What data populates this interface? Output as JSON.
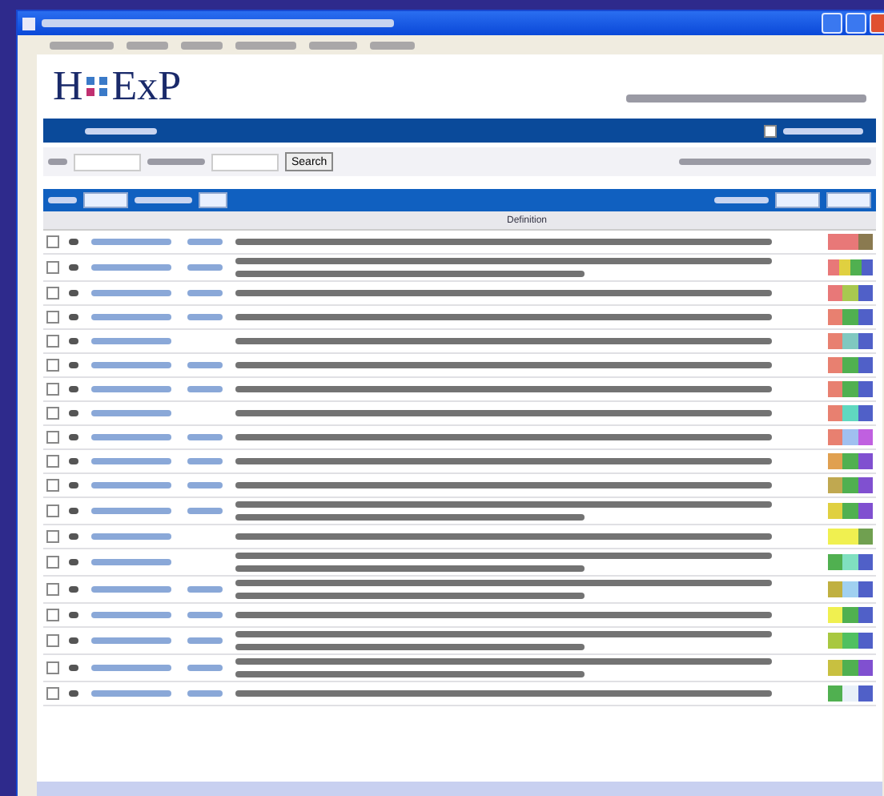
{
  "logo": {
    "left": "H",
    "right": "ExP"
  },
  "nav": {
    "checked": false
  },
  "search": {
    "button": "Search"
  },
  "table": {
    "header": "Definition",
    "rows": [
      {
        "checked": false,
        "kind": "single",
        "ref_link": true,
        "segments": [
          {
            "color": "#e87878"
          },
          {
            "color": "#e87878"
          },
          {
            "color": "#8a7a50"
          }
        ]
      },
      {
        "checked": false,
        "kind": "double",
        "ref_link": true,
        "segments": [
          {
            "color": "#e87878"
          },
          {
            "color": "#e0d040"
          },
          {
            "color": "#50b050"
          },
          {
            "color": "#5060c8"
          }
        ]
      },
      {
        "checked": false,
        "kind": "single",
        "ref_link": true,
        "segments": [
          {
            "color": "#e87878"
          },
          {
            "color": "#a8c850"
          },
          {
            "color": "#5060c8"
          }
        ]
      },
      {
        "checked": false,
        "kind": "single",
        "ref_link": true,
        "segments": [
          {
            "color": "#e88070"
          },
          {
            "color": "#50b050"
          },
          {
            "color": "#5060c8"
          }
        ]
      },
      {
        "checked": false,
        "kind": "single",
        "ref_link": false,
        "segments": [
          {
            "color": "#e88070"
          },
          {
            "color": "#80c8c0"
          },
          {
            "color": "#5060c8"
          }
        ]
      },
      {
        "checked": false,
        "kind": "single",
        "ref_link": true,
        "segments": [
          {
            "color": "#e88070"
          },
          {
            "color": "#50b050"
          },
          {
            "color": "#5060c8"
          }
        ]
      },
      {
        "checked": false,
        "kind": "single",
        "ref_link": true,
        "segments": [
          {
            "color": "#e88070"
          },
          {
            "color": "#50b050"
          },
          {
            "color": "#5060c8"
          }
        ]
      },
      {
        "checked": false,
        "kind": "single",
        "ref_link": false,
        "segments": [
          {
            "color": "#e88070"
          },
          {
            "color": "#60d8c0"
          },
          {
            "color": "#5060c8"
          }
        ]
      },
      {
        "checked": false,
        "kind": "single",
        "ref_link": true,
        "segments": [
          {
            "color": "#e88070"
          },
          {
            "color": "#a0c0f0"
          },
          {
            "color": "#c060e0"
          }
        ]
      },
      {
        "checked": false,
        "kind": "single",
        "ref_link": true,
        "segments": [
          {
            "color": "#e0a050"
          },
          {
            "color": "#50b050"
          },
          {
            "color": "#8050d0"
          }
        ]
      },
      {
        "checked": false,
        "kind": "single",
        "ref_link": true,
        "segments": [
          {
            "color": "#c0a850"
          },
          {
            "color": "#50b050"
          },
          {
            "color": "#8050d0"
          }
        ]
      },
      {
        "checked": false,
        "kind": "double",
        "ref_link": true,
        "segments": [
          {
            "color": "#e0d040"
          },
          {
            "color": "#50b050"
          },
          {
            "color": "#8050d0"
          }
        ]
      },
      {
        "checked": false,
        "kind": "single",
        "ref_link": false,
        "segments": [
          {
            "color": "#f0f050"
          },
          {
            "color": "#f0f050"
          },
          {
            "color": "#70a050"
          }
        ]
      },
      {
        "checked": false,
        "kind": "double",
        "ref_link": false,
        "segments": [
          {
            "color": "#50b050"
          },
          {
            "color": "#80e0c0"
          },
          {
            "color": "#5060c8"
          }
        ]
      },
      {
        "checked": false,
        "kind": "double",
        "ref_link": true,
        "segments": [
          {
            "color": "#c0b040"
          },
          {
            "color": "#a0d0f0"
          },
          {
            "color": "#5060c8"
          }
        ]
      },
      {
        "checked": false,
        "kind": "single",
        "ref_link": true,
        "segments": [
          {
            "color": "#f0f050"
          },
          {
            "color": "#50b050"
          },
          {
            "color": "#5060c8"
          }
        ]
      },
      {
        "checked": false,
        "kind": "double",
        "ref_link": true,
        "segments": [
          {
            "color": "#a8c840"
          },
          {
            "color": "#50c060"
          },
          {
            "color": "#5060c8"
          }
        ]
      },
      {
        "checked": false,
        "kind": "double",
        "ref_link": true,
        "segments": [
          {
            "color": "#c8c040"
          },
          {
            "color": "#50b050"
          },
          {
            "color": "#8050d0"
          }
        ]
      },
      {
        "checked": false,
        "kind": "single",
        "ref_link": true,
        "segments": [
          {
            "color": "#50b050"
          },
          {
            "color": "#e8f0f8"
          },
          {
            "color": "#5060c8"
          }
        ]
      }
    ]
  }
}
